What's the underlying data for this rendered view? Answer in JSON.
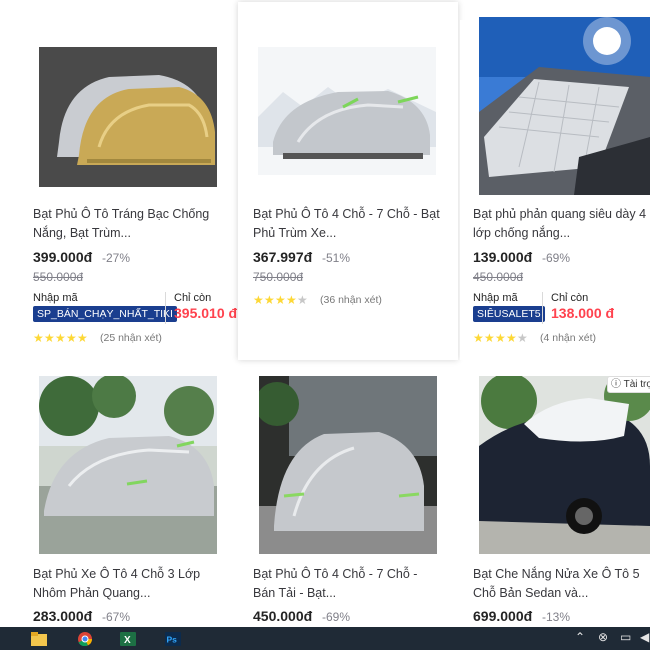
{
  "products": [
    {
      "title": "Bạt Phủ Ô Tô Tráng Bạc Chống Nắng, Bạt Trùm...",
      "price": "399.000đ",
      "discount": "-27%",
      "old_price": "550.000đ",
      "coupon_label": "Nhập mã",
      "coupon_code": "SP_BÁN_CHẠY_NHẤT_TIKI",
      "only_label": "Chỉ còn",
      "only_price": "395.010 đ",
      "rating": 4.5,
      "reviews": "(25 nhận xét)",
      "image_icon": "gold-silver-car-cover-image"
    },
    {
      "title": "Bạt Phủ Ô Tô 4 Chỗ - 7 Chỗ - Bạt Phủ Trùm Xe...",
      "price": "367.997đ",
      "discount": "-51%",
      "old_price": "750.000đ",
      "rating": 4,
      "reviews": "(36 nhận xét)",
      "image_icon": "silver-car-cover-image"
    },
    {
      "title": "Bạt phủ phản quang siêu dày 4 lớp chống nắng...",
      "price": "139.000đ",
      "discount": "-69%",
      "old_price": "450.000đ",
      "coupon_label": "Nhập mã",
      "coupon_code": "SIÊUSALET5",
      "only_label": "Chỉ còn",
      "only_price": "138.000 đ",
      "rating": 3.5,
      "reviews": "(4 nhận xét)",
      "image_icon": "windshield-sunshade-image"
    },
    {
      "title": "Bạt Phủ Xe Ô Tô 4 Chỗ 3 Lớp Nhôm Phản Quang...",
      "price": "283.000đ",
      "discount": "-67%",
      "image_icon": "silver-car-cover-outdoor-image"
    },
    {
      "title": "Bạt Phủ Ô Tô 4 Chỗ - 7 Chỗ - Bán Tải - Bạt...",
      "price": "450.000đ",
      "discount": "-69%",
      "image_icon": "silver-car-cover-street-image"
    },
    {
      "title": "Bạt Che Nắng Nửa Xe Ô Tô 5 Chỗ Bản Sedan và...",
      "price": "699.000đ",
      "discount": "-13%",
      "image_icon": "half-car-cover-sedan-image"
    }
  ],
  "ad_badge": "ⓘ Tài trợ",
  "colors": {
    "price_red": "#ff424e",
    "coupon_blue": "#1a3e8f",
    "star_yellow": "#fdd836",
    "taskbar": "#1f2a36"
  },
  "taskbar": {
    "icons": [
      "file-explorer-icon",
      "chrome-icon",
      "excel-icon",
      "photoshop-icon"
    ],
    "excel_glyph": "X",
    "photoshop_glyph": "Ps"
  }
}
